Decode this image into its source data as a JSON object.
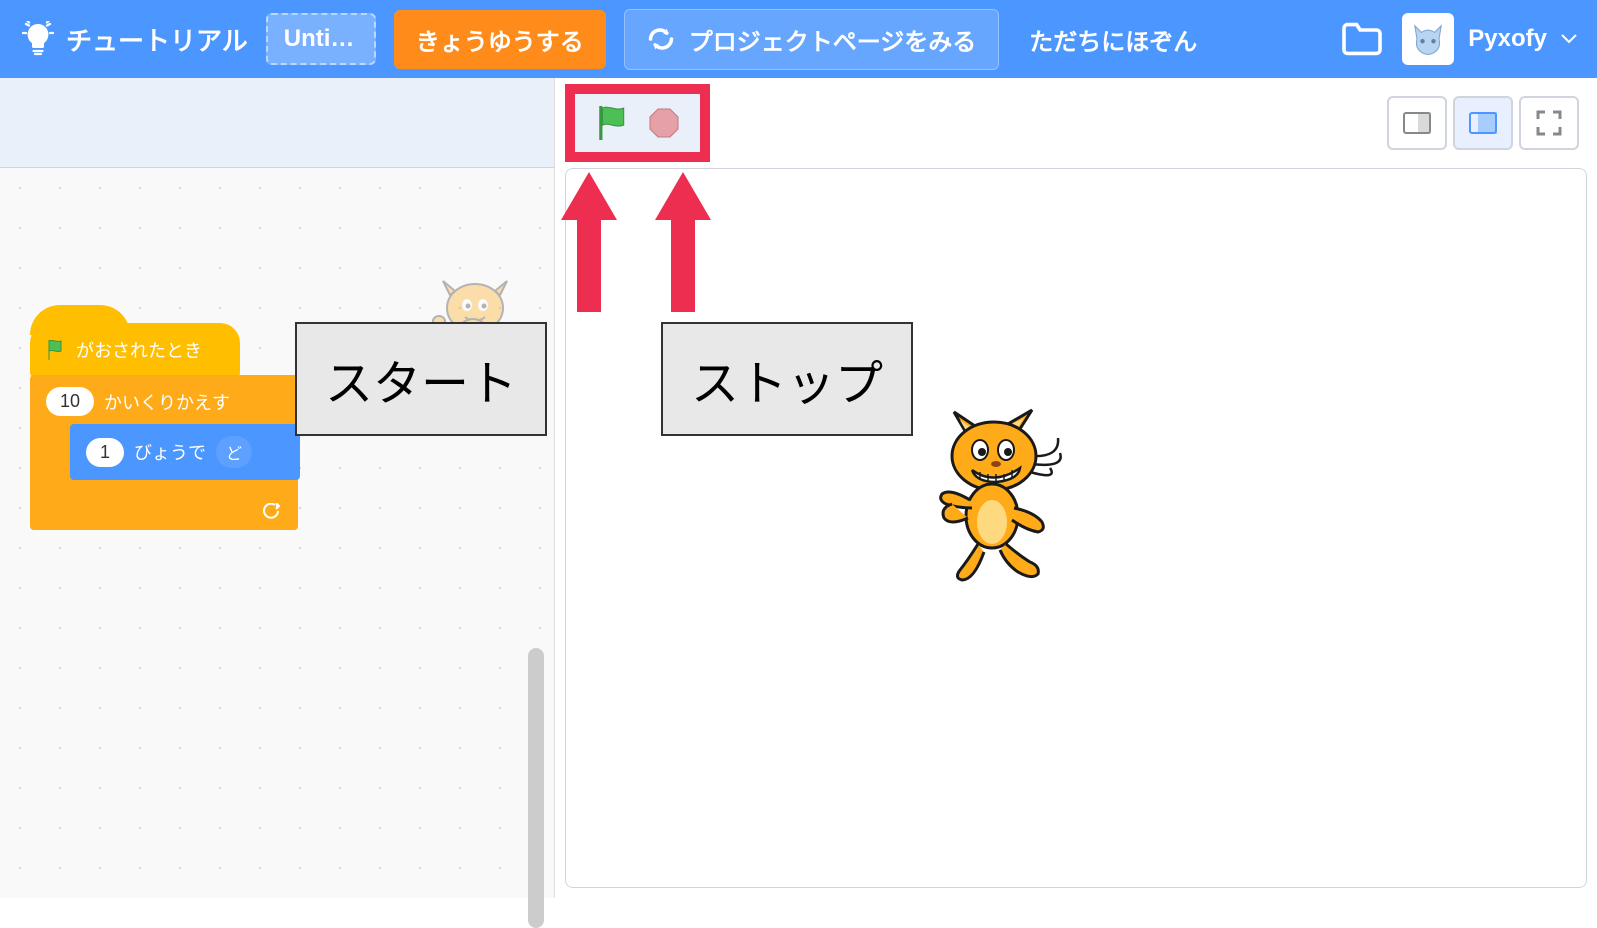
{
  "header": {
    "tutorial": "チュートリアル",
    "title": "Untit…",
    "share": "きょうゆうする",
    "viewProject": "プロジェクトページをみる",
    "saveNow": "ただちにほぞん",
    "username": "Pyxofy"
  },
  "annotations": {
    "start": "スタート",
    "stop": "ストップ"
  },
  "blocks": {
    "whenFlagClicked": "がおされたとき",
    "repeatCount": "10",
    "repeatLabel": "かいくりかえす",
    "glideSecs": "1",
    "glideLabel": "びょうで",
    "glideTarget": "ど"
  }
}
